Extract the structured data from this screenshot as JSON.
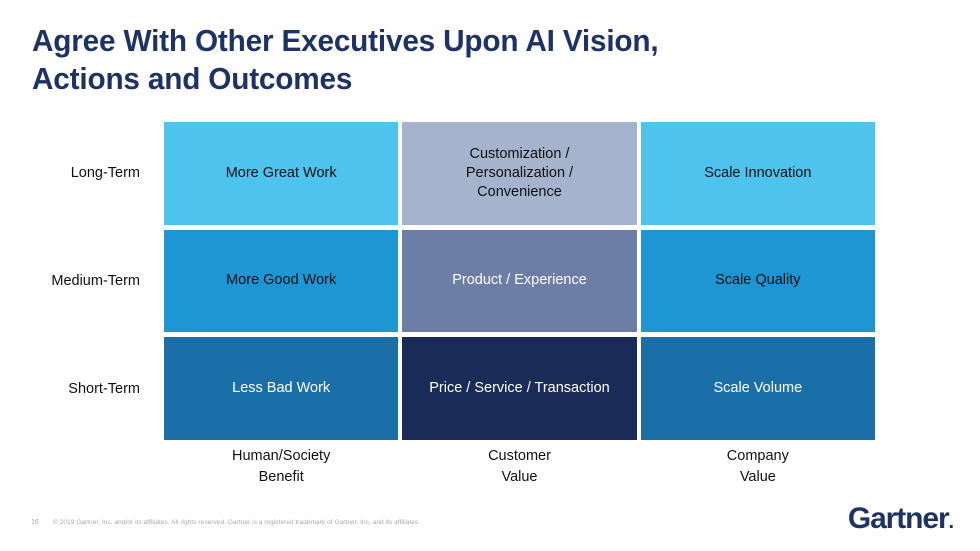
{
  "slide": {
    "title": "Agree With Other Executives Upon AI Vision,\nActions and Outcomes",
    "page_number": "16",
    "copyright": "© 2019 Gartner, Inc. and/or its affiliates. All rights reserved. Gartner is a registered trademark of Gartner, Inc. and its affiliates.",
    "logo_text": "Gartner",
    "logo_dot": "."
  },
  "colors": {
    "title_navy": "#1e3264",
    "light_blue": "#4ec3ee",
    "medium_blue": "#1e96d3",
    "dark_blue": "#1b6fa8",
    "light_slate": "#a5b3cc",
    "mid_slate": "#6c7da6",
    "navy": "#1a2b57",
    "text_black": "#101010",
    "text_white": "#ffffff",
    "footer_gray": "#a8a8a8"
  },
  "matrix": {
    "row_labels": [
      "Long-Term",
      "Medium-Term",
      "Short-Term"
    ],
    "column_labels": [
      "Human/Society\nBenefit",
      "Customer\nValue",
      "Company\nValue"
    ],
    "cells": [
      {
        "text": "More Great Work",
        "bg": "#4ec3ee",
        "fg": "#101010",
        "row": "Long-Term",
        "column": "Human/Society Benefit"
      },
      {
        "text": "Customization /\nPersonalization /\nConvenience",
        "bg": "#a5b3cc",
        "fg": "#101010",
        "row": "Long-Term",
        "column": "Customer Value"
      },
      {
        "text": "Scale Innovation",
        "bg": "#4ec3ee",
        "fg": "#101010",
        "row": "Long-Term",
        "column": "Company Value"
      },
      {
        "text": "More Good Work",
        "bg": "#1e96d3",
        "fg": "#101010",
        "row": "Medium-Term",
        "column": "Human/Society Benefit"
      },
      {
        "text": "Product / Experience",
        "bg": "#6c7da6",
        "fg": "#ffffff",
        "row": "Medium-Term",
        "column": "Customer Value"
      },
      {
        "text": "Scale Quality",
        "bg": "#1e96d3",
        "fg": "#101010",
        "row": "Medium-Term",
        "column": "Company Value"
      },
      {
        "text": "Less Bad Work",
        "bg": "#1b6fa8",
        "fg": "#ffffff",
        "row": "Short-Term",
        "column": "Human/Society Benefit"
      },
      {
        "text": "Price / Service / Transaction",
        "bg": "#1a2b57",
        "fg": "#ffffff",
        "row": "Short-Term",
        "column": "Customer Value"
      },
      {
        "text": "Scale Volume",
        "bg": "#1b6fa8",
        "fg": "#ffffff",
        "row": "Short-Term",
        "column": "Company Value"
      }
    ]
  }
}
